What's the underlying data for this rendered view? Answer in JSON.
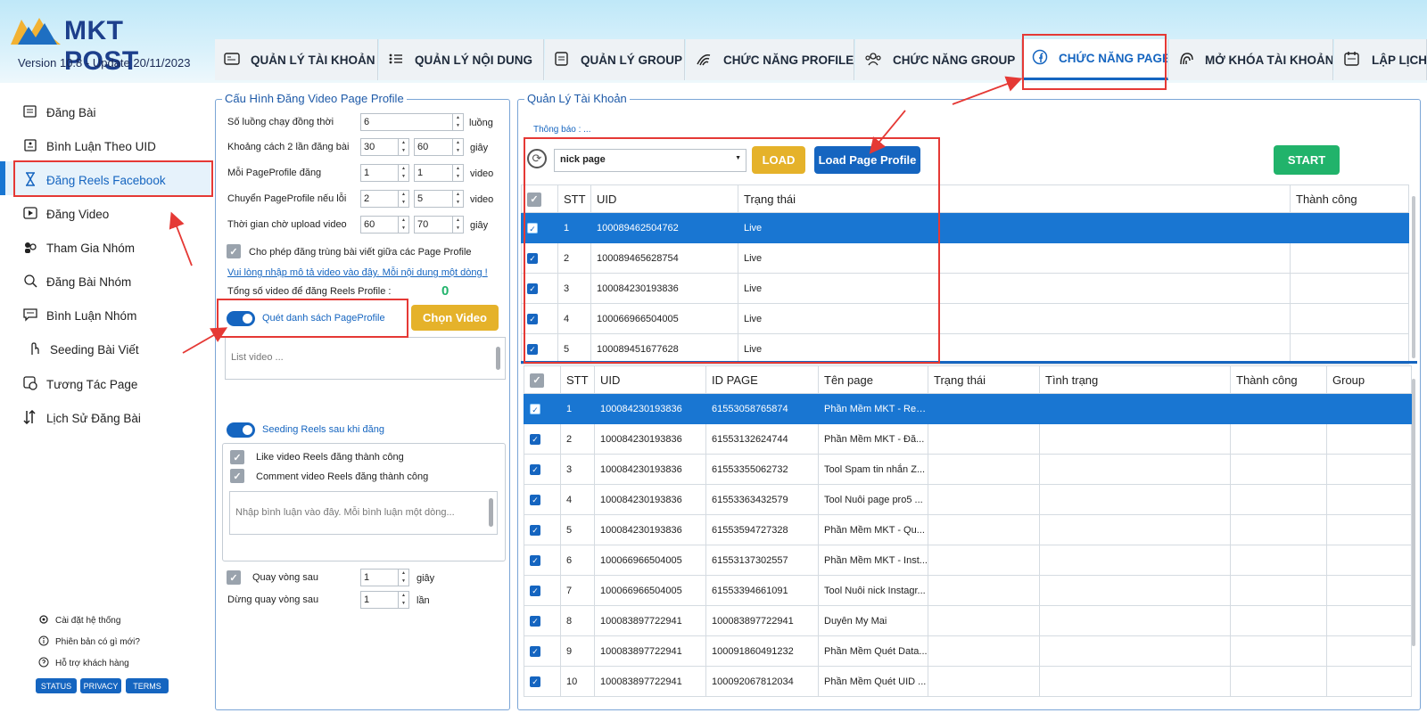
{
  "app": {
    "logo_text": "MKT POST",
    "version_label": "Version  10.8   - Update  20/11/2023"
  },
  "tabs": [
    {
      "label": "QUẢN LÝ TÀI KHOẢN",
      "icon": "id-card-icon"
    },
    {
      "label": "QUẢN LÝ NỘI DUNG",
      "icon": "list-icon"
    },
    {
      "label": "QUẢN LÝ GROUP",
      "icon": "document-icon"
    },
    {
      "label": "CHỨC NĂNG PROFILE",
      "icon": "fingerprint-icon"
    },
    {
      "label": "CHỨC NĂNG GROUP",
      "icon": "group-icon"
    },
    {
      "label": "CHỨC NĂNG PAGE",
      "icon": "facebook-icon"
    },
    {
      "label": "MỞ KHÓA TÀI KHOẢN",
      "icon": "unlock-icon"
    },
    {
      "label": "LẬP LỊCH",
      "icon": "calendar-icon"
    }
  ],
  "sidebar": {
    "items": [
      {
        "label": "Đăng Bài",
        "icon": "post-icon"
      },
      {
        "label": "Bình Luận Theo UID",
        "icon": "comment-uid-icon"
      },
      {
        "label": "Đăng Reels Facebook",
        "icon": "hourglass-icon"
      },
      {
        "label": "Đăng Video",
        "icon": "video-icon"
      },
      {
        "label": "Tham Gia Nhóm",
        "icon": "join-group-icon"
      },
      {
        "label": "Đăng Bài Nhóm",
        "icon": "group-post-icon"
      },
      {
        "label": "Bình Luận Nhóm",
        "icon": "group-comment-icon"
      },
      {
        "label": "Seeding Bài Viết",
        "icon": "hand-icon"
      },
      {
        "label": "Tương Tác Page",
        "icon": "interact-icon"
      },
      {
        "label": "Lịch Sử Đăng Bài",
        "icon": "history-icon"
      }
    ],
    "footer": [
      {
        "label": "Cài đặt hệ thống",
        "icon": "gear-icon"
      },
      {
        "label": "Phiên bản có gì mới?",
        "icon": "info-icon"
      },
      {
        "label": "Hỗ trợ khách hàng",
        "icon": "help-icon"
      }
    ],
    "pills": [
      "STATUS",
      "PRIVACY",
      "TERMS"
    ]
  },
  "config": {
    "title": "Cấu Hình Đăng Video Page Profile",
    "rows": [
      {
        "label": "Số luồng chạy đồng thời",
        "v1": "6",
        "unit": "luồng"
      },
      {
        "label": "Khoảng cách 2 lần đăng bài",
        "v1": "30",
        "v2": "60",
        "unit": "giây"
      },
      {
        "label": "Mỗi PageProfile đăng",
        "v1": "1",
        "v2": "1",
        "unit": "video"
      },
      {
        "label": "Chuyển PageProfile nếu lỗi",
        "v1": "2",
        "v2": "5",
        "unit": "video"
      },
      {
        "label": "Thời gian chờ upload video",
        "v1": "60",
        "v2": "70",
        "unit": "giây"
      }
    ],
    "allow_duplicate": "Cho phép đăng trùng bài viết giữa các Page Profile",
    "desc_link": "Vui lòng nhập mô tả video vào đây. Mỗi nội dung một dòng !",
    "total_label": "Tổng số video để đăng Reels Profile :",
    "total_value": "0",
    "scan_label": "Quét danh sách PageProfile",
    "choose_video": "Chọn Video",
    "list_placeholder": "List video ...",
    "seeding_label": "Seeding Reels sau khi đăng",
    "like_label": "Like video Reels đăng thành công",
    "comment_label": "Comment video Reels đăng thành công",
    "comment_placeholder": "Nhập bình luận vào đây. Mỗi bình luận một dòng...",
    "loop_label": "Quay vòng sau",
    "loop_value": "1",
    "loop_unit": "giây",
    "stop_label": "Dừng quay vòng sau",
    "stop_value": "1",
    "stop_unit": "lần"
  },
  "accounts": {
    "title": "Quản Lý Tài Khoản",
    "notice": "Thông báo : ...",
    "select_value": "nick page",
    "load": "LOAD",
    "load_page": "Load Page Profile",
    "start": "START",
    "headers": [
      "STT",
      "UID",
      "Trạng thái",
      "Thành công"
    ],
    "rows": [
      {
        "stt": "1",
        "uid": "100089462504762",
        "status": "Live"
      },
      {
        "stt": "2",
        "uid": "100089465628754",
        "status": "Live"
      },
      {
        "stt": "3",
        "uid": "100084230193836",
        "status": "Live"
      },
      {
        "stt": "4",
        "uid": "100066966504005",
        "status": "Live"
      },
      {
        "stt": "5",
        "uid": "100089451677628",
        "status": "Live"
      }
    ]
  },
  "pages": {
    "headers": [
      "STT",
      "UID",
      "ID PAGE",
      "Tên page",
      "Trạng thái",
      "Tình trạng",
      "Thành công",
      "Group"
    ],
    "rows": [
      {
        "stt": "1",
        "uid": "100084230193836",
        "page_id": "61553058765874",
        "name": "Phần Mềm MKT - Reu..."
      },
      {
        "stt": "2",
        "uid": "100084230193836",
        "page_id": "61553132624744",
        "name": "Phần Mềm MKT - Đă..."
      },
      {
        "stt": "3",
        "uid": "100084230193836",
        "page_id": "61553355062732",
        "name": "Tool Spam tin nhắn Z..."
      },
      {
        "stt": "4",
        "uid": "100084230193836",
        "page_id": "61553363432579",
        "name": "Tool Nuôi page pro5 ..."
      },
      {
        "stt": "5",
        "uid": "100084230193836",
        "page_id": "61553594727328",
        "name": "Phần Mềm MKT - Qu..."
      },
      {
        "stt": "6",
        "uid": "100066966504005",
        "page_id": "61553137302557",
        "name": "Phần Mềm MKT - Inst..."
      },
      {
        "stt": "7",
        "uid": "100066966504005",
        "page_id": "61553394661091",
        "name": "Tool Nuôi nick Instagr..."
      },
      {
        "stt": "8",
        "uid": "100083897722941",
        "page_id": "100083897722941",
        "name": "Duyên My Mai"
      },
      {
        "stt": "9",
        "uid": "100083897722941",
        "page_id": "100091860491232",
        "name": "Phần Mềm Quét Data..."
      },
      {
        "stt": "10",
        "uid": "100083897722941",
        "page_id": "100092067812034",
        "name": "Phần Mềm Quét UID ..."
      }
    ]
  },
  "colors": {
    "accent": "#1565c0",
    "highlight": "#e53935",
    "load": "#e5b22a",
    "start": "#21b36b",
    "selected_row": "#1976d2"
  }
}
